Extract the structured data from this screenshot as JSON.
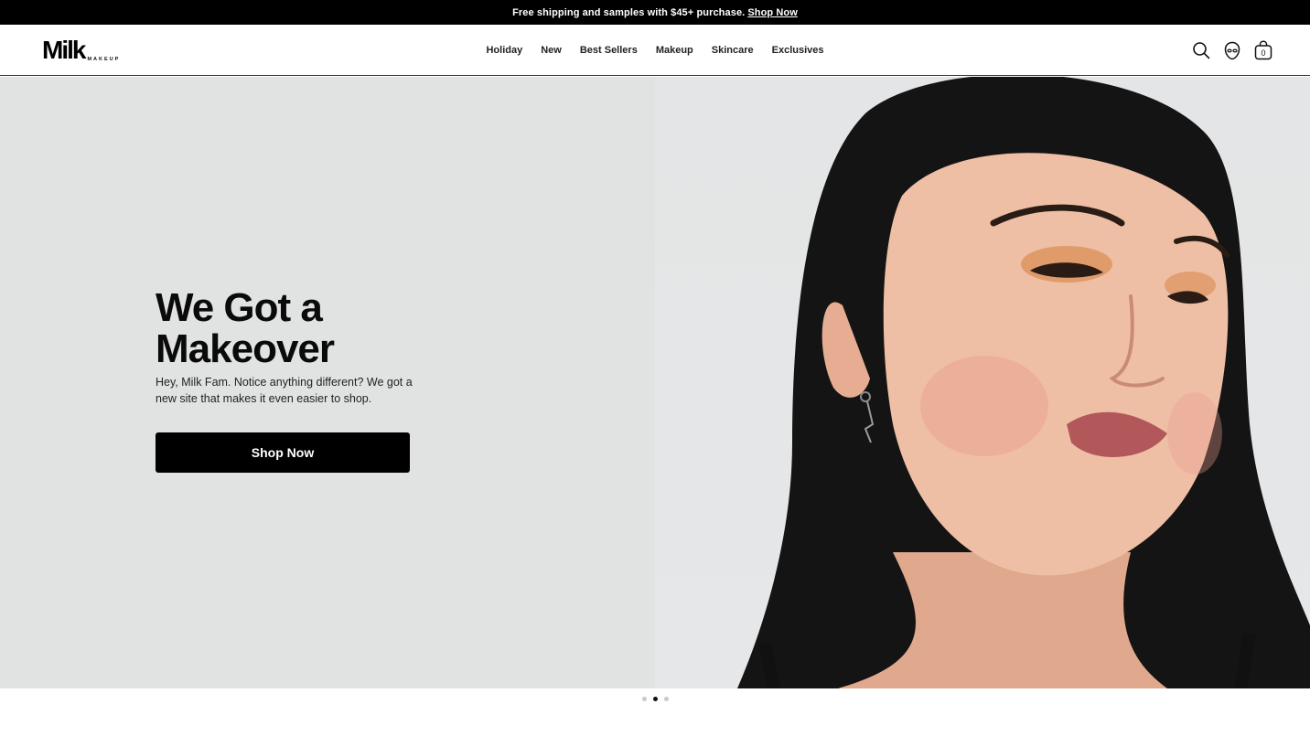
{
  "promo_bar": {
    "text": "Free shipping and samples with $45+ purchase.",
    "link_label": "Shop Now"
  },
  "header": {
    "logo_text": "Milk",
    "logo_subtext": "MAKEUP",
    "nav_items": [
      {
        "label": "Holiday"
      },
      {
        "label": "New"
      },
      {
        "label": "Best Sellers"
      },
      {
        "label": "Makeup"
      },
      {
        "label": "Skincare"
      },
      {
        "label": "Exclusives"
      }
    ],
    "icons": {
      "search": "search-icon",
      "account": "alien-account-icon",
      "cart": "shopping-bag-icon",
      "cart_count": "0"
    }
  },
  "hero": {
    "title_line1": "We Got a",
    "title_line2": "Makeover",
    "subtitle": "Hey, Milk Fam. Notice anything different? We got a new site that makes it even easier to shop.",
    "cta_label": "Shop Now",
    "image": "model-portrait"
  },
  "carousel": {
    "slide_count": 3,
    "active_slide": 2
  },
  "colors": {
    "promo_bg": "#000000",
    "hero_bg": "#e1e3e3",
    "cta_bg": "#000000",
    "cta_text": "#ffffff"
  }
}
